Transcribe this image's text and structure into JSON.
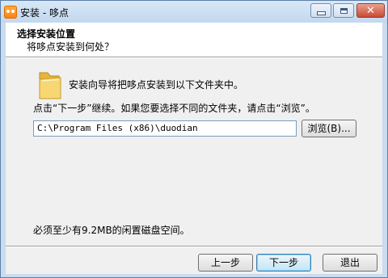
{
  "window": {
    "title": "安装 - 哆点",
    "controls": [
      "minimize-icon",
      "maximize-icon",
      "close-icon"
    ]
  },
  "header": {
    "title": "选择安装位置",
    "subtitle": "将哆点安装到何处？"
  },
  "content": {
    "intro": "安装向导将把哆点安装到以下文件夹中。",
    "instruction": "点击“下一步”继续。如果您要选择不同的文件夹，请点击“浏览”。",
    "path_value": "C:\\Program Files (x86)\\duodian",
    "browse_label": "浏览(B)...",
    "space_note": "必须至少有9.2MB的闲置磁盘空间。"
  },
  "footer": {
    "back_label": "上一步",
    "next_label": "下一步",
    "cancel_label": "退出"
  },
  "colors": {
    "frame": "#c9dcf0",
    "close_button": "#c94a30",
    "folder": "#f2c94c"
  }
}
